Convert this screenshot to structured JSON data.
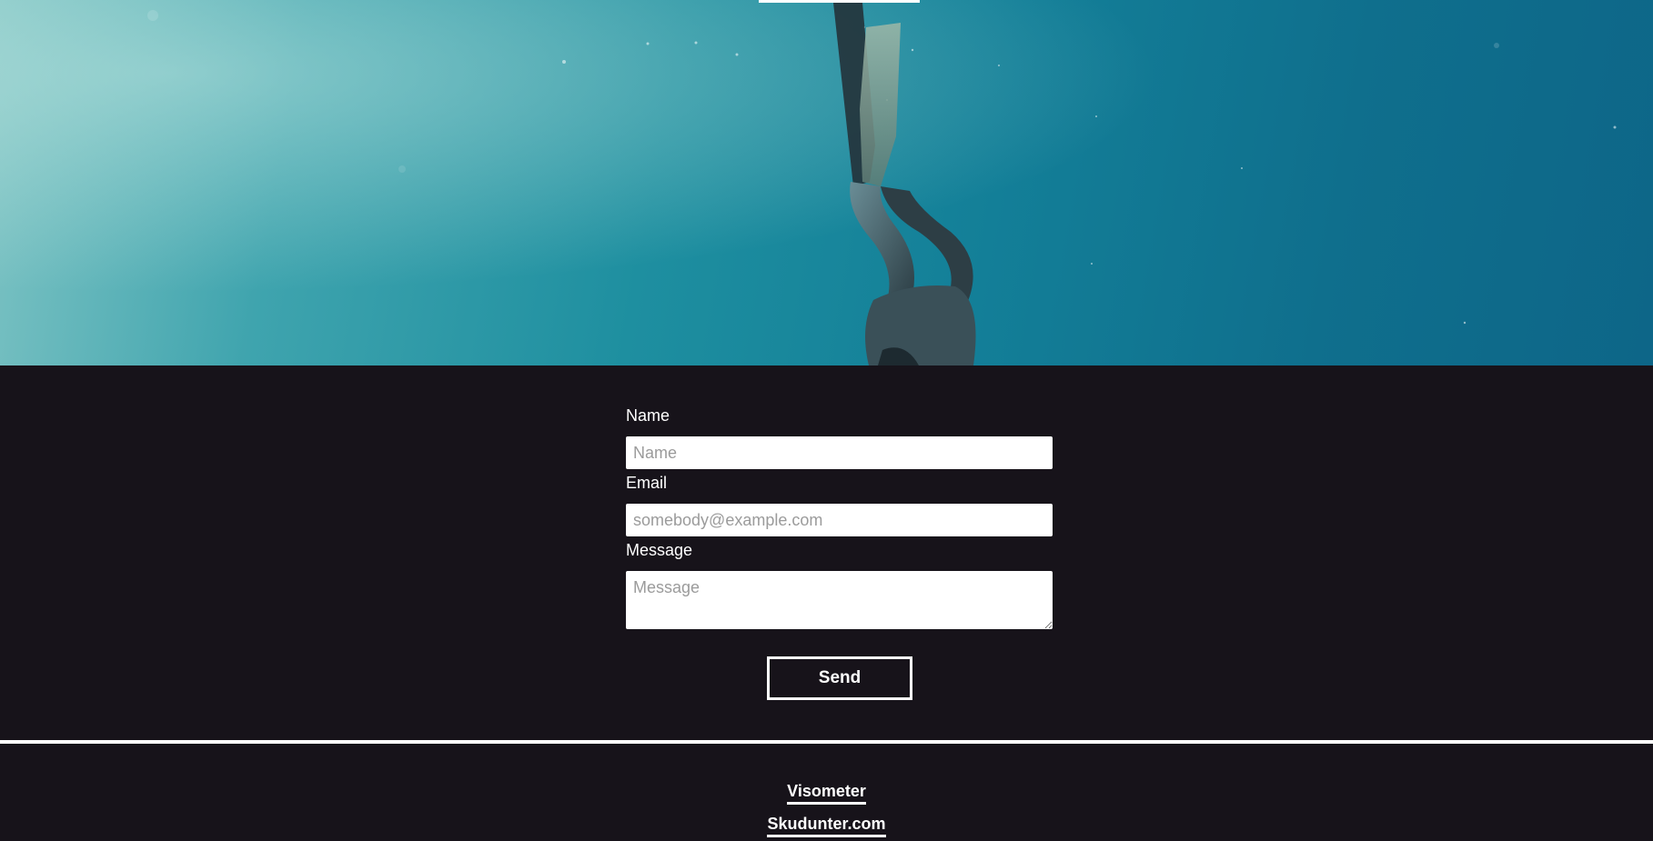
{
  "hero": {
    "image_subject": "underwater-freediver-with-fins"
  },
  "form": {
    "name": {
      "label": "Name",
      "placeholder": "Name",
      "value": ""
    },
    "email": {
      "label": "Email",
      "placeholder": "somebody@example.com",
      "value": ""
    },
    "message": {
      "label": "Message",
      "placeholder": "Message",
      "value": ""
    },
    "send_label": "Send"
  },
  "footer": {
    "links": [
      {
        "label": "Visometer"
      },
      {
        "label": "Skudunter.com"
      }
    ]
  },
  "colors": {
    "background": "#17131a",
    "text": "#ffffff",
    "water_light": "#7fc4c4",
    "water_dark": "#0d6688"
  }
}
